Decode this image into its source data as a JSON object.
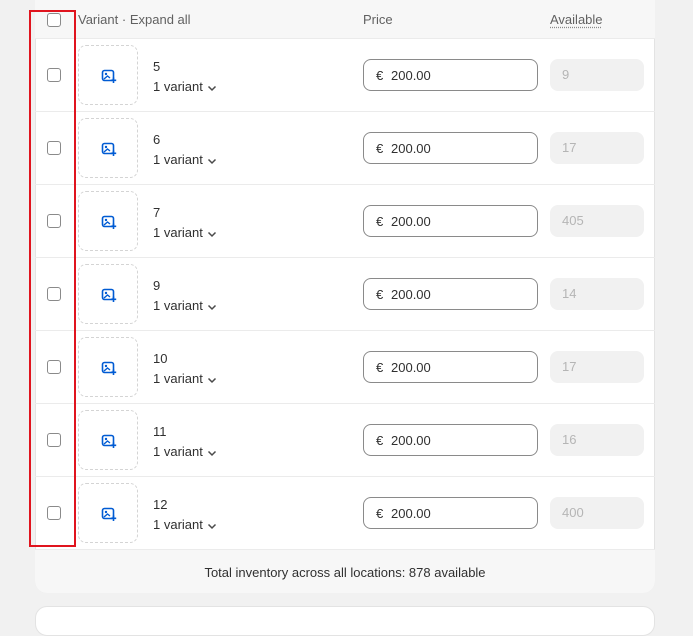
{
  "header": {
    "variant_label": "Variant",
    "separator": "·",
    "expand_all_label": "Expand all",
    "price_label": "Price",
    "available_label": "Available"
  },
  "rows": [
    {
      "name": "5",
      "variants": "1 variant",
      "currency": "€",
      "price": "200.00",
      "available": "9"
    },
    {
      "name": "6",
      "variants": "1 variant",
      "currency": "€",
      "price": "200.00",
      "available": "17"
    },
    {
      "name": "7",
      "variants": "1 variant",
      "currency": "€",
      "price": "200.00",
      "available": "405"
    },
    {
      "name": "9",
      "variants": "1 variant",
      "currency": "€",
      "price": "200.00",
      "available": "14"
    },
    {
      "name": "10",
      "variants": "1 variant",
      "currency": "€",
      "price": "200.00",
      "available": "17"
    },
    {
      "name": "11",
      "variants": "1 variant",
      "currency": "€",
      "price": "200.00",
      "available": "16"
    },
    {
      "name": "12",
      "variants": "1 variant",
      "currency": "€",
      "price": "200.00",
      "available": "400"
    }
  ],
  "footer": {
    "total_text": "Total inventory across all locations: 878 available"
  },
  "colors": {
    "highlight": "#e0141e",
    "icon_blue": "#005bd3"
  }
}
